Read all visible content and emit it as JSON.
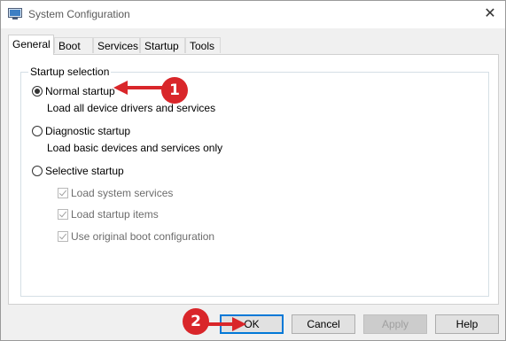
{
  "window": {
    "title": "System Configuration",
    "close_glyph": "✕"
  },
  "tabs": [
    {
      "label": "General",
      "active": true
    },
    {
      "label": "Boot",
      "active": false
    },
    {
      "label": "Services",
      "active": false
    },
    {
      "label": "Startup",
      "active": false
    },
    {
      "label": "Tools",
      "active": false
    }
  ],
  "startup_selection": {
    "group_label": "Startup selection",
    "options": [
      {
        "label": "Normal startup",
        "description": "Load all device drivers and services",
        "selected": true
      },
      {
        "label": "Diagnostic startup",
        "description": "Load basic devices and services only",
        "selected": false
      },
      {
        "label": "Selective startup",
        "description": "",
        "selected": false
      }
    ],
    "selective_items": [
      {
        "label": "Load system services",
        "checked": true,
        "enabled": false
      },
      {
        "label": "Load startup items",
        "checked": true,
        "enabled": false
      },
      {
        "label": "Use original boot configuration",
        "checked": true,
        "enabled": false
      }
    ]
  },
  "buttons": {
    "ok": "OK",
    "cancel": "Cancel",
    "apply": "Apply",
    "help": "Help"
  },
  "annotations": [
    {
      "number": "1"
    },
    {
      "number": "2"
    }
  ],
  "colors": {
    "annotation_red": "#d9262a",
    "focus_blue": "#0078d7"
  },
  "icons": {
    "app_icon": "system-configuration-icon",
    "close": "close-icon"
  }
}
